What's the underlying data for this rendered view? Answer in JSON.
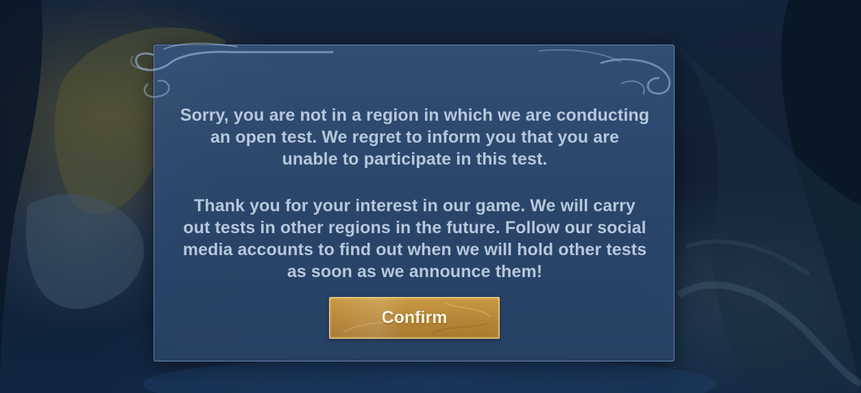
{
  "dialog": {
    "message_lines": [
      "Sorry, you are not in a region in which we are conducting",
      "an open test. We regret to inform you that you are",
      "unable to participate in this test."
    ],
    "followup_lines": [
      "Thank you for your interest in our game. We will carry",
      "out tests in other regions in the future. Follow our social",
      "media accounts to find out when we will hold other tests",
      "as soon as we announce them!"
    ],
    "confirm_label": "Confirm"
  },
  "colors": {
    "panel": "#34527a",
    "panel_border": "#96b9e1",
    "text": "#b7c7dc",
    "button_gold": "#c99a45",
    "button_text": "#fff6e2"
  }
}
